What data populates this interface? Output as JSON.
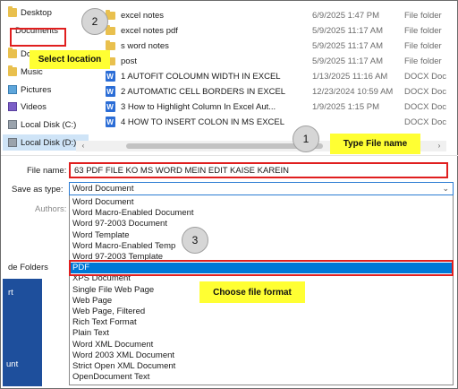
{
  "nav": {
    "items": [
      {
        "label": "Desktop",
        "icon": "folder-icon"
      },
      {
        "label": "Documents",
        "icon": "none"
      },
      {
        "label": "Dow",
        "icon": "folder-icon"
      },
      {
        "label": "Music",
        "icon": "folder-icon"
      },
      {
        "label": "Pictures",
        "icon": "pictures-icon"
      },
      {
        "label": "Videos",
        "icon": "videos-icon"
      },
      {
        "label": "Local Disk (C:)",
        "icon": "drive-icon"
      },
      {
        "label": "Local Disk (D:)",
        "icon": "drive-icon"
      }
    ]
  },
  "files": [
    {
      "name": "excel notes",
      "date": "6/9/2025 1:47 PM",
      "type": "File folder",
      "icon": "folder-icon"
    },
    {
      "name": "excel notes pdf",
      "date": "5/9/2025 11:17 AM",
      "type": "File folder",
      "icon": "folder-icon"
    },
    {
      "name": "s word notes",
      "date": "5/9/2025 11:17 AM",
      "type": "File folder",
      "icon": "folder-icon"
    },
    {
      "name": "post",
      "date": "5/9/2025 11:17 AM",
      "type": "File folder",
      "icon": "folder-icon"
    },
    {
      "name": "1 AUTOFIT COLOUMN WIDTH IN EXCEL",
      "date": "1/13/2025 11:16 AM",
      "type": "DOCX Doc",
      "icon": "word-doc-icon"
    },
    {
      "name": "2 AUTOMATIC CELL BORDERS IN EXCEL ...",
      "date": "12/23/2024 10:59 AM",
      "type": "DOCX Doc",
      "icon": "word-doc-icon"
    },
    {
      "name": "3  How to Highlight Column In Excel Aut...",
      "date": "1/9/2025 1:15 PM",
      "type": "DOCX Doc",
      "icon": "word-doc-icon"
    },
    {
      "name": "4  HOW TO INSERT COLON IN MS EXCEL ...",
      "date": "",
      "type": "DOCX Doc",
      "icon": "word-doc-icon"
    }
  ],
  "form": {
    "file_name_label": "File name:",
    "file_name_value": "63 PDF FILE KO MS WORD MEIN EDIT  KAISE KAREIN",
    "save_as_type_label": "Save as type:",
    "save_as_type_value": "Word Document",
    "authors_label": "Authors:",
    "hide_folders_label": "de Folders"
  },
  "save_types": [
    "Word Document",
    "Word Macro-Enabled Document",
    "Word 97-2003 Document",
    "Word Template",
    "Word Macro-Enabled Temp",
    "Word 97-2003 Template",
    "PDF",
    "XPS Document",
    "Single File Web Page",
    "Web Page",
    "Web Page, Filtered",
    "Rich Text Format",
    "Plain Text",
    "Word XML Document",
    "Word 2003 XML Document",
    "Strict Open XML Document",
    "OpenDocument Text"
  ],
  "selected_type_index": 6,
  "backstage": {
    "item1": "rt",
    "item2": "unt"
  },
  "annotations": {
    "step1": {
      "number": "1",
      "text": "Type File name"
    },
    "step2": {
      "number": "2",
      "text": "Select location"
    },
    "step3": {
      "number": "3",
      "text": "Choose file format"
    }
  },
  "colors": {
    "highlight_outline": "#e01f1f",
    "callout_bg": "#ffff33",
    "selection_blue": "#0078d7"
  }
}
